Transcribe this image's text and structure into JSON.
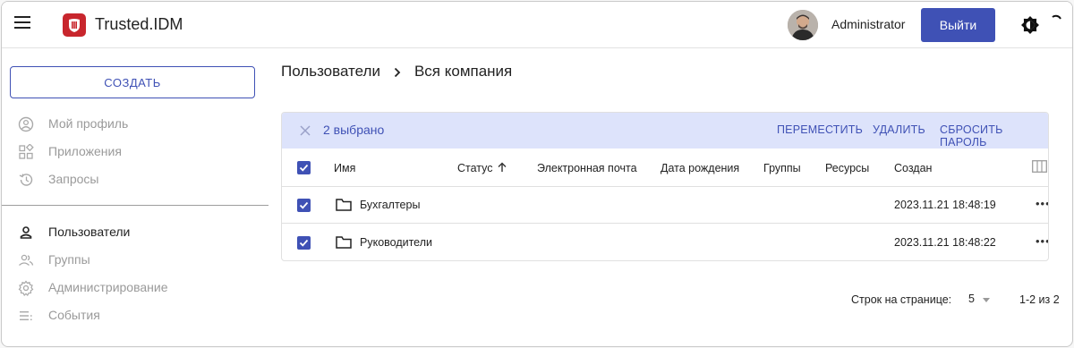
{
  "header": {
    "app_title": "Trusted.IDM",
    "username": "Administrator",
    "logout_label": "Выйти",
    "accent": "#3f51b5",
    "logo_color": "#c8262d"
  },
  "sidebar": {
    "create_label": "СОЗДАТЬ",
    "items": [
      {
        "label": "Мой профиль",
        "icon": "account-circle-icon"
      },
      {
        "label": "Приложения",
        "icon": "apps-icon"
      },
      {
        "label": "Запросы",
        "icon": "history-icon"
      },
      {
        "label": "Пользователи",
        "icon": "person-icon"
      },
      {
        "label": "Группы",
        "icon": "group-icon"
      },
      {
        "label": "Администрирование",
        "icon": "settings-icon"
      },
      {
        "label": "События",
        "icon": "events-list-icon"
      }
    ],
    "active_item": "Пользователи"
  },
  "breadcrumb": {
    "section": "Пользователи",
    "current": "Вся компания"
  },
  "selection_bar": {
    "count_text": "2 выбрано",
    "actions": [
      "ПЕРЕМЕСТИТЬ",
      "УДАЛИТЬ",
      "СБРОСИТЬ ПАРОЛЬ"
    ],
    "background": "#dde3fb"
  },
  "table": {
    "columns": [
      "Имя",
      "Статус",
      "Электронная почта",
      "Дата рождения",
      "Группы",
      "Ресурсы",
      "Создан"
    ],
    "sorted_column": "Статус",
    "sort_direction": "ascending",
    "rows": [
      {
        "name": "Бухгалтеры",
        "created": "2023.11.21 18:48:19",
        "checked": true,
        "type": "folder"
      },
      {
        "name": "Руководители",
        "created": "2023.11.21 18:48:22",
        "checked": true,
        "type": "folder"
      }
    ],
    "row_menu": "•••"
  },
  "pagination": {
    "rows_per_page_label": "Строк на странице:",
    "rows_per_page_value": "5",
    "range_text": "1-2 из 2"
  }
}
